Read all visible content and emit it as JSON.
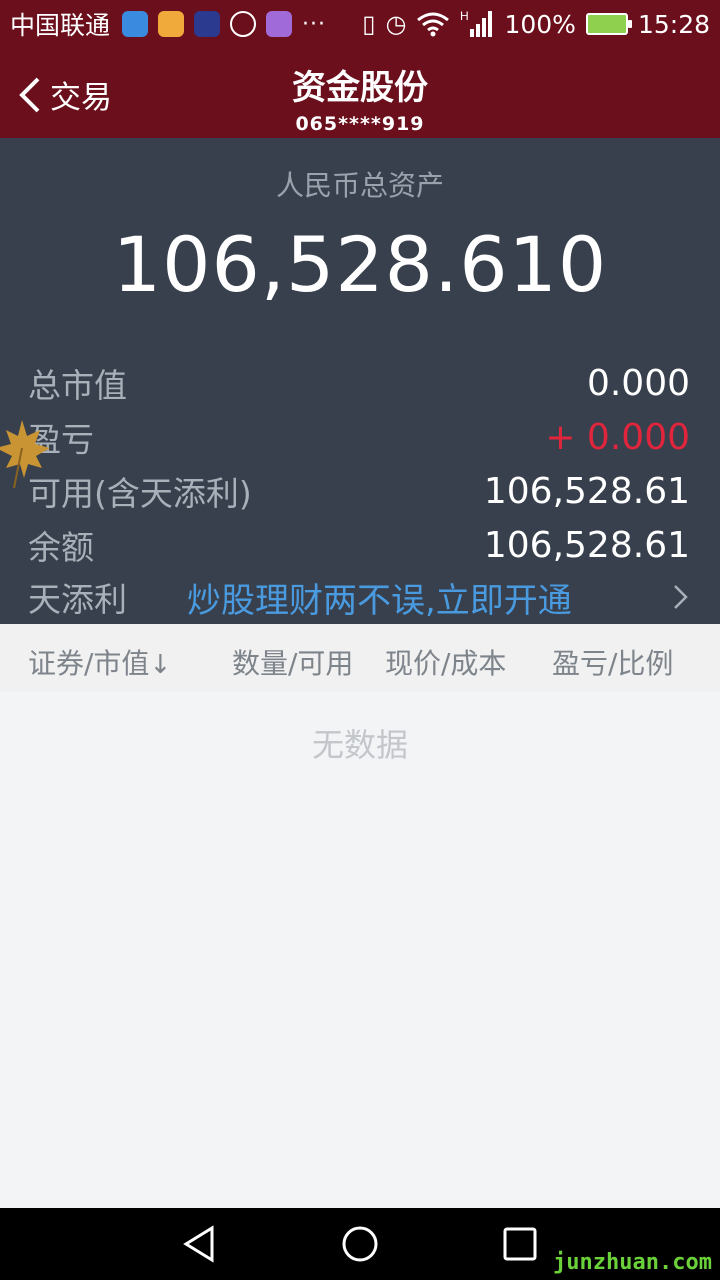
{
  "status_bar": {
    "carrier": "中国联通",
    "dots": "···",
    "network_tag": "H",
    "battery": "100%",
    "time": "15:28"
  },
  "header": {
    "back_label": "交易",
    "title": "资金股份",
    "account": "065****919"
  },
  "assets": {
    "total_label": "人民币总资产",
    "total_value": "106,528.610",
    "rows": [
      {
        "label": "总市值",
        "value": "0.000"
      },
      {
        "label": "盈亏",
        "value": "+ 0.000"
      },
      {
        "label": "可用(含天添利)",
        "value": "106,528.61"
      },
      {
        "label": "余额",
        "value": "106,528.61"
      }
    ],
    "promo_label": "天添利",
    "promo_text": "炒股理财两不误,立即开通"
  },
  "table": {
    "columns": [
      "证券/市值",
      "数量/可用",
      "现价/成本",
      "盈亏/比例"
    ],
    "sort_arrow": "↓",
    "empty_text": "无数据"
  },
  "watermark": "junzhuan.com",
  "colors": {
    "header_bg": "#6b0f1c",
    "panel_bg": "#37404c",
    "loss_red": "#e0253c",
    "promo_blue": "#4a9ae0"
  }
}
